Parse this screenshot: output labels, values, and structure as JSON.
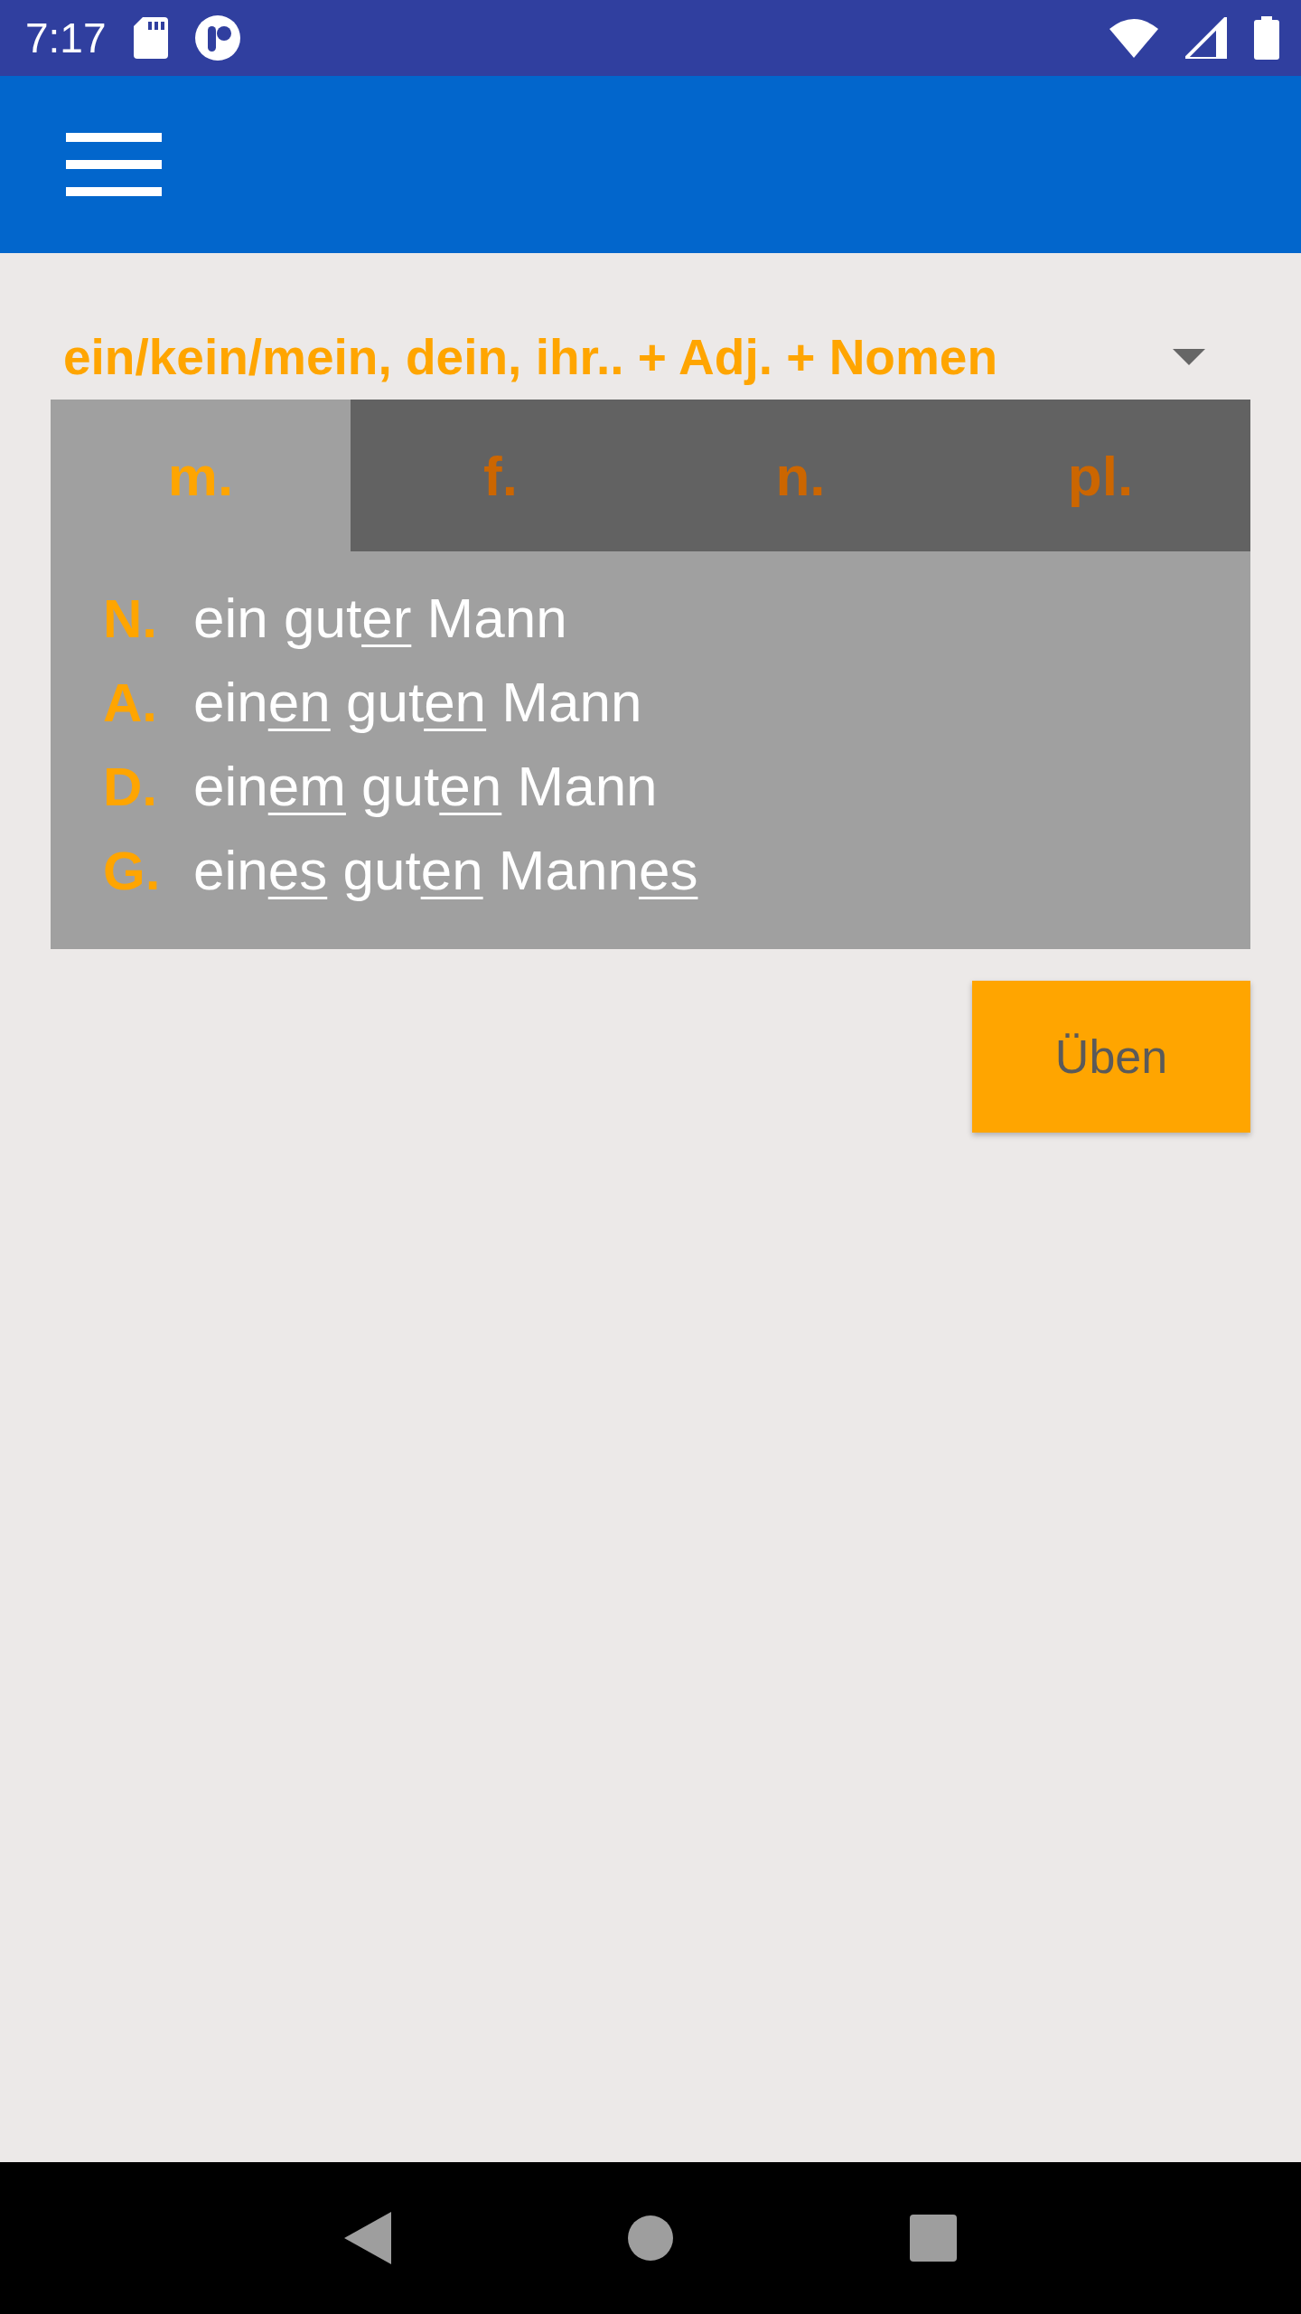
{
  "status_bar": {
    "time": "7:17"
  },
  "selector": {
    "value": "ein/kein/mein, dein, ihr.. + Adj. + Nomen"
  },
  "tabs": [
    {
      "label": "m.",
      "selected": true
    },
    {
      "label": "f.",
      "selected": false
    },
    {
      "label": "n.",
      "selected": false
    },
    {
      "label": "pl.",
      "selected": false
    }
  ],
  "declension": [
    {
      "case": "N.",
      "parts": [
        {
          "text": "ein gut",
          "underlined": false
        },
        {
          "text": "er",
          "underlined": true
        },
        {
          "text": " Mann",
          "underlined": false
        }
      ]
    },
    {
      "case": "A.",
      "parts": [
        {
          "text": "ein",
          "underlined": false
        },
        {
          "text": "en",
          "underlined": true
        },
        {
          "text": " gut",
          "underlined": false
        },
        {
          "text": "en",
          "underlined": true
        },
        {
          "text": " Mann",
          "underlined": false
        }
      ]
    },
    {
      "case": "D.",
      "parts": [
        {
          "text": "ein",
          "underlined": false
        },
        {
          "text": "em",
          "underlined": true
        },
        {
          "text": " gut",
          "underlined": false
        },
        {
          "text": "en",
          "underlined": true
        },
        {
          "text": " Mann",
          "underlined": false
        }
      ]
    },
    {
      "case": "G.",
      "parts": [
        {
          "text": "ein",
          "underlined": false
        },
        {
          "text": "es",
          "underlined": true
        },
        {
          "text": " gut",
          "underlined": false
        },
        {
          "text": "en",
          "underlined": true
        },
        {
          "text": " Mann",
          "underlined": false
        },
        {
          "text": "es",
          "underlined": true
        }
      ]
    }
  ],
  "practice_button": {
    "label": "Üben"
  }
}
